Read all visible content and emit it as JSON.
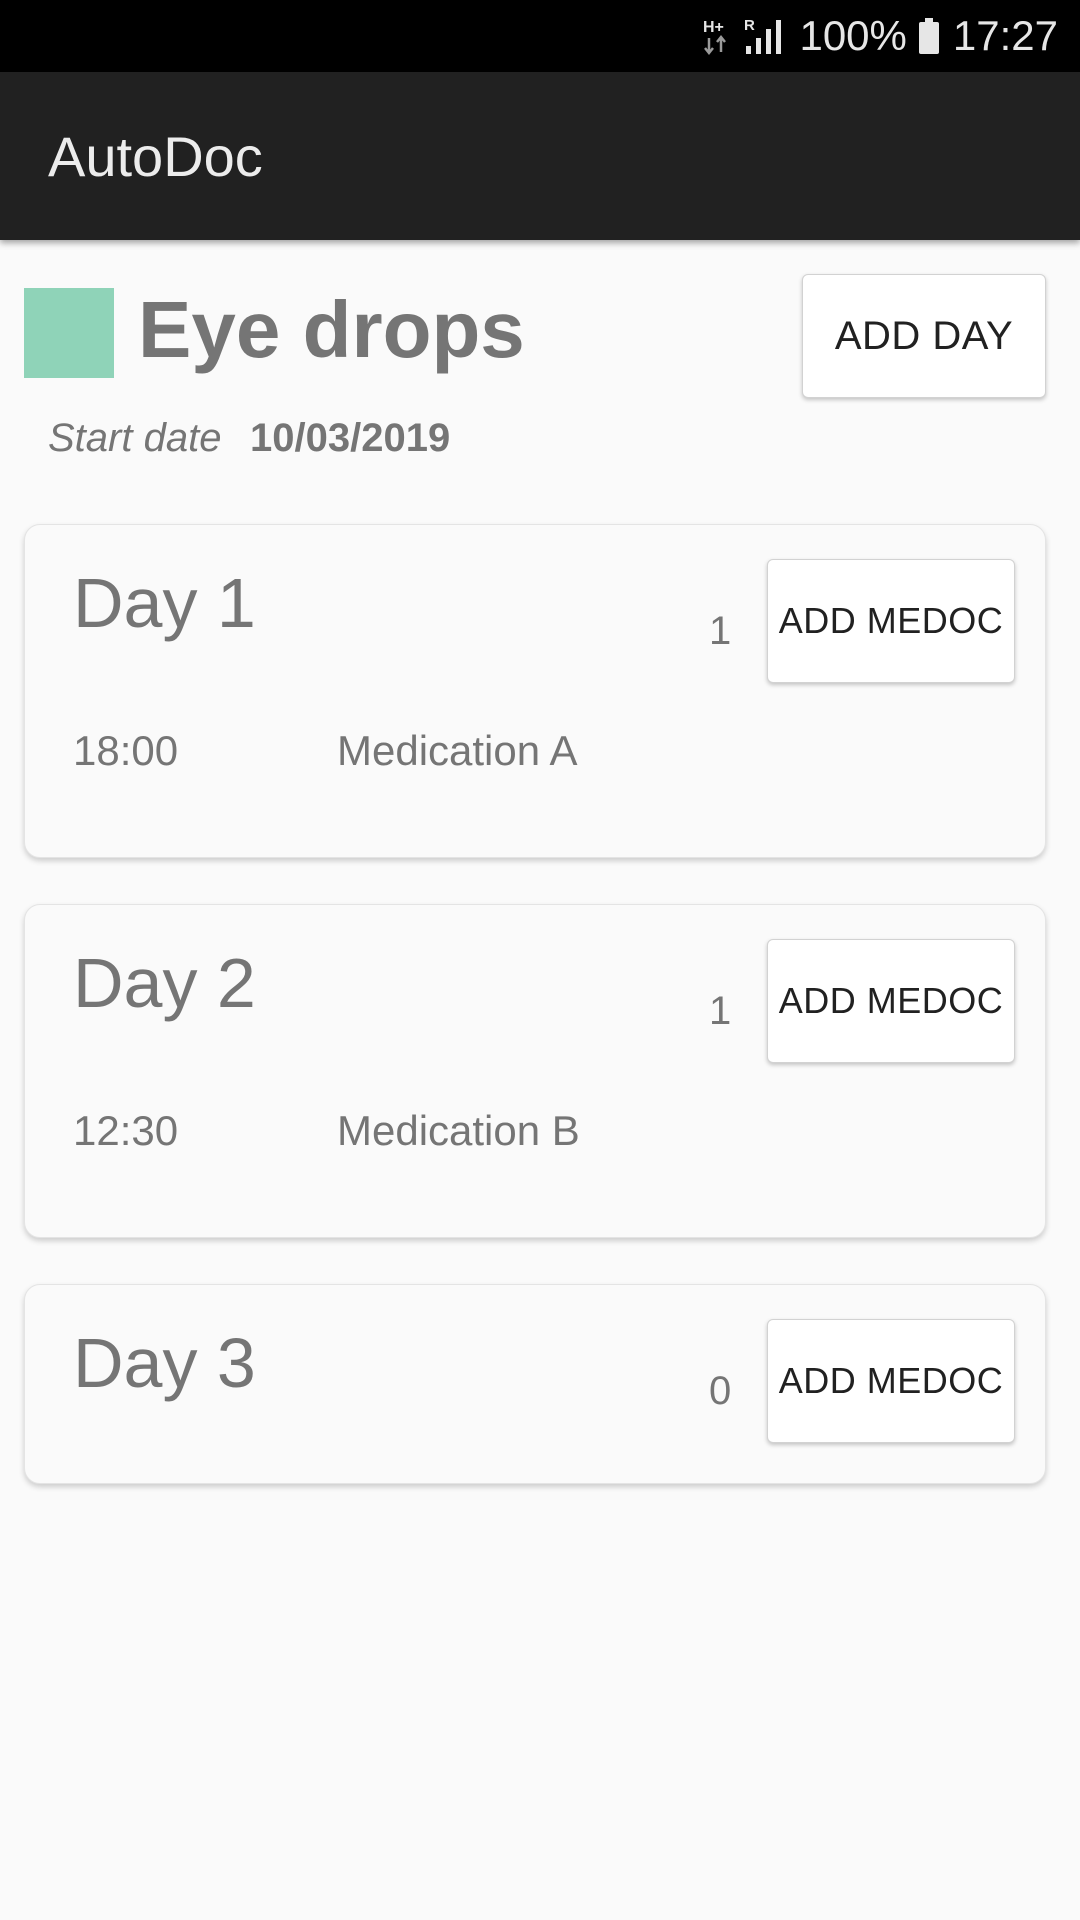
{
  "status_bar": {
    "network_type": "H+",
    "roaming": "R",
    "battery": "100%",
    "time": "17:27"
  },
  "app": {
    "title": "AutoDoc"
  },
  "treatment": {
    "name": "Eye drops",
    "color": "#8fd3b8",
    "start_label": "Start date",
    "start_date": "10/03/2019",
    "add_day_label": "ADD DAY"
  },
  "days": [
    {
      "title": "Day 1",
      "count": "1",
      "add_label": "ADD MEDOC",
      "entries": [
        {
          "time": "18:00",
          "name": "Medication A"
        }
      ]
    },
    {
      "title": "Day 2",
      "count": "1",
      "add_label": "ADD MEDOC",
      "entries": [
        {
          "time": "12:30",
          "name": "Medication B"
        }
      ]
    },
    {
      "title": "Day 3",
      "count": "0",
      "add_label": "ADD MEDOC",
      "entries": []
    }
  ],
  "icons": {
    "network": "network-type-icon",
    "signal": "signal-strength-icon",
    "battery": "battery-icon"
  }
}
